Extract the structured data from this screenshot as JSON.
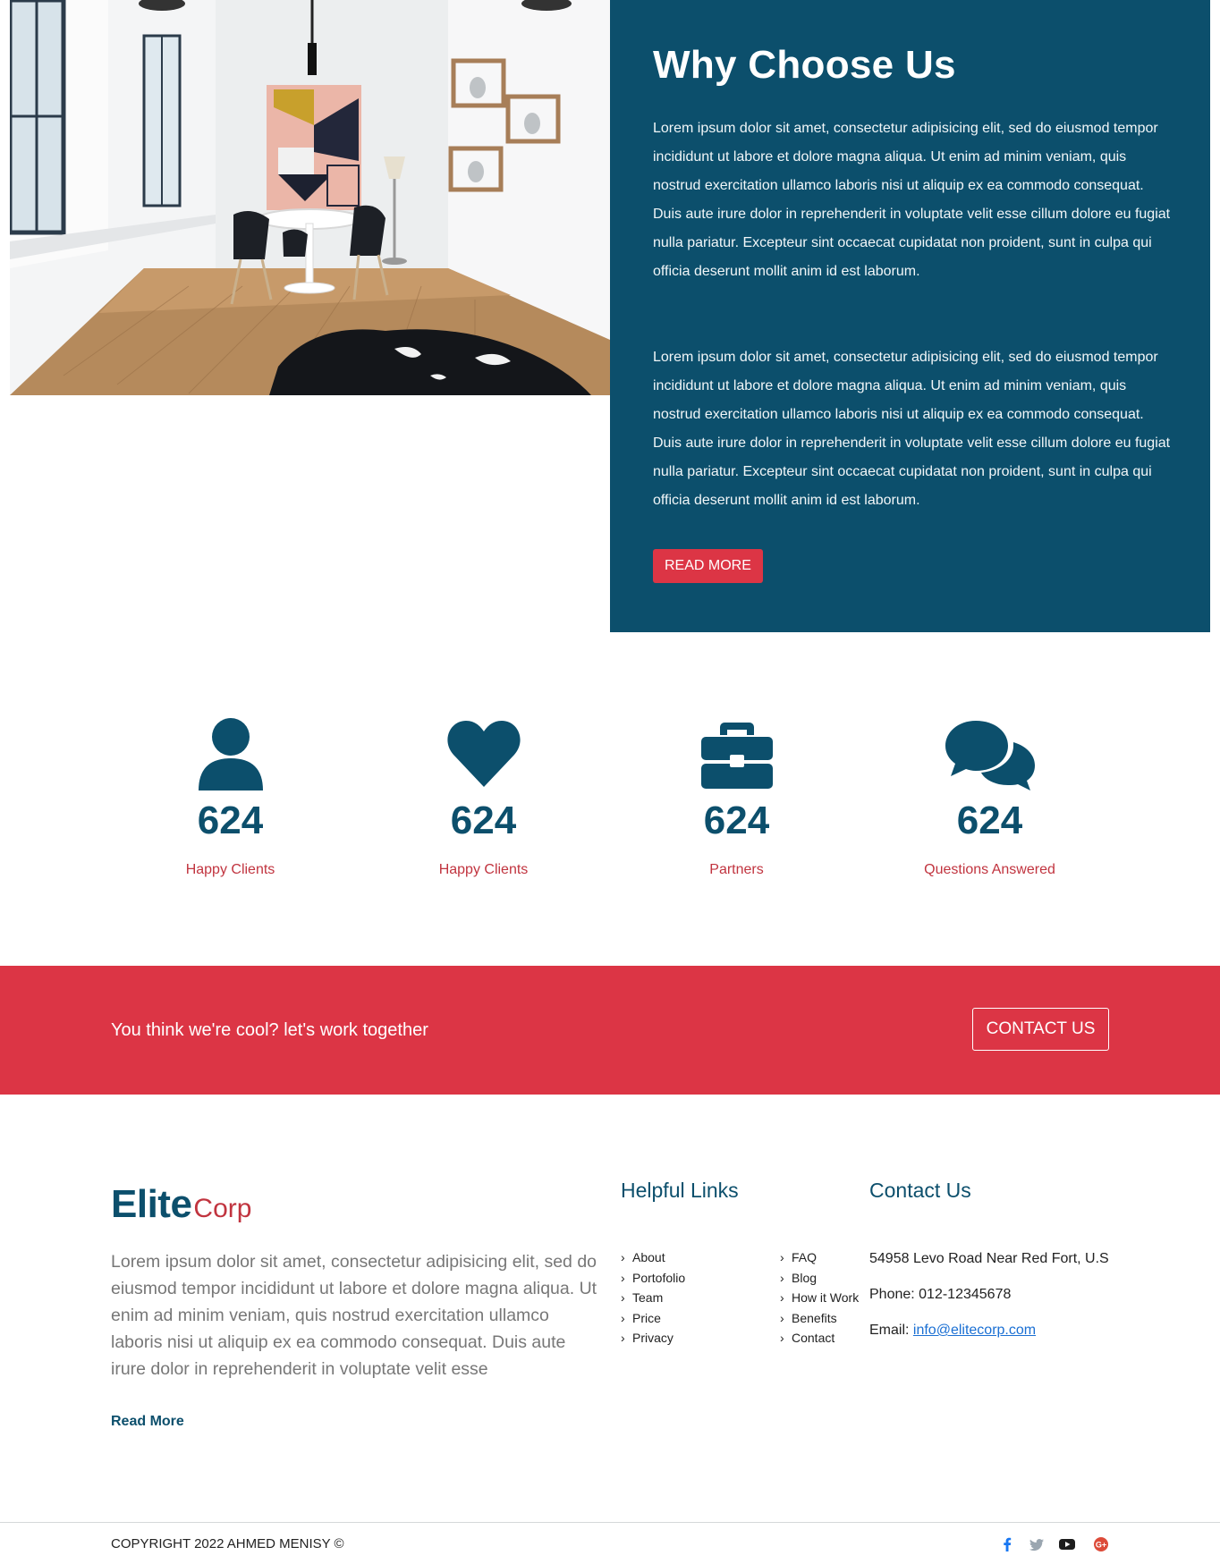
{
  "why": {
    "title": "Why Choose Us",
    "paragraph_1": "Lorem ipsum dolor sit amet, consectetur adipisicing elit, sed do eiusmod tempor incididunt ut labore et dolore magna aliqua. Ut enim ad minim veniam, quis nostrud exercitation ullamco laboris nisi ut aliquip ex ea commodo consequat. Duis aute irure dolor in reprehenderit in voluptate velit esse cillum dolore eu fugiat nulla pariatur. Excepteur sint occaecat cupidatat non proident, sunt in culpa qui officia deserunt mollit anim id est laborum.",
    "paragraph_2": "Lorem ipsum dolor sit amet, consectetur adipisicing elit, sed do eiusmod tempor incididunt ut labore et dolore magna aliqua. Ut enim ad minim veniam, quis nostrud exercitation ullamco laboris nisi ut aliquip ex ea commodo consequat. Duis aute irure dolor in reprehenderit in voluptate velit esse cillum dolore eu fugiat nulla pariatur. Excepteur sint occaecat cupidatat non proident, sunt in culpa qui officia deserunt mollit anim id est laborum.",
    "button_label": "Read More",
    "photo": "interior-dining-room-photo"
  },
  "stats": [
    {
      "icon": "user-icon",
      "number": "624",
      "label": "Happy Clients"
    },
    {
      "icon": "heart-icon",
      "number": "624",
      "label": "Happy Clients"
    },
    {
      "icon": "briefcase-icon",
      "number": "624",
      "label": "Partners"
    },
    {
      "icon": "comments-icon",
      "number": "624",
      "label": "Questions Answered"
    }
  ],
  "cta": {
    "text": "You think we're cool? let's work together",
    "button_label": "Contact Us"
  },
  "footer": {
    "logo_main": "Elite",
    "logo_sub": "Corp",
    "about_text": "Lorem ipsum dolor sit amet, consectetur adipisicing elit, sed do eiusmod tempor incididunt ut labore et dolore magna aliqua. Ut enim ad minim veniam, quis nostrud exercitation ullamco laboris nisi ut aliquip ex ea commodo consequat. Duis aute irure dolor in reprehenderit in voluptate velit esse",
    "read_more": "Read More",
    "links_title": "Helpful Links",
    "links_col_1": [
      "About",
      "Portofolio",
      "Team",
      "Price",
      "Privacy"
    ],
    "links_col_2": [
      "FAQ",
      "Blog",
      "How it Work",
      "Benefits",
      "Contact"
    ],
    "contact_title": "Contact Us",
    "address": "54958 Levo Road Near Red Fort, U.S",
    "phone": "Phone: 012-12345678",
    "email_label": "Email:",
    "email": "info@elitecorp.com"
  },
  "bottom": {
    "copyright": "Copyright 2022 Ahmed Menisy ©",
    "social": [
      "facebook-icon",
      "twitter-icon",
      "youtube-icon",
      "google-plus-icon"
    ]
  },
  "colors": {
    "primary": "#0c4f6c",
    "accent": "#dc3545",
    "label_red": "#c1343f"
  }
}
